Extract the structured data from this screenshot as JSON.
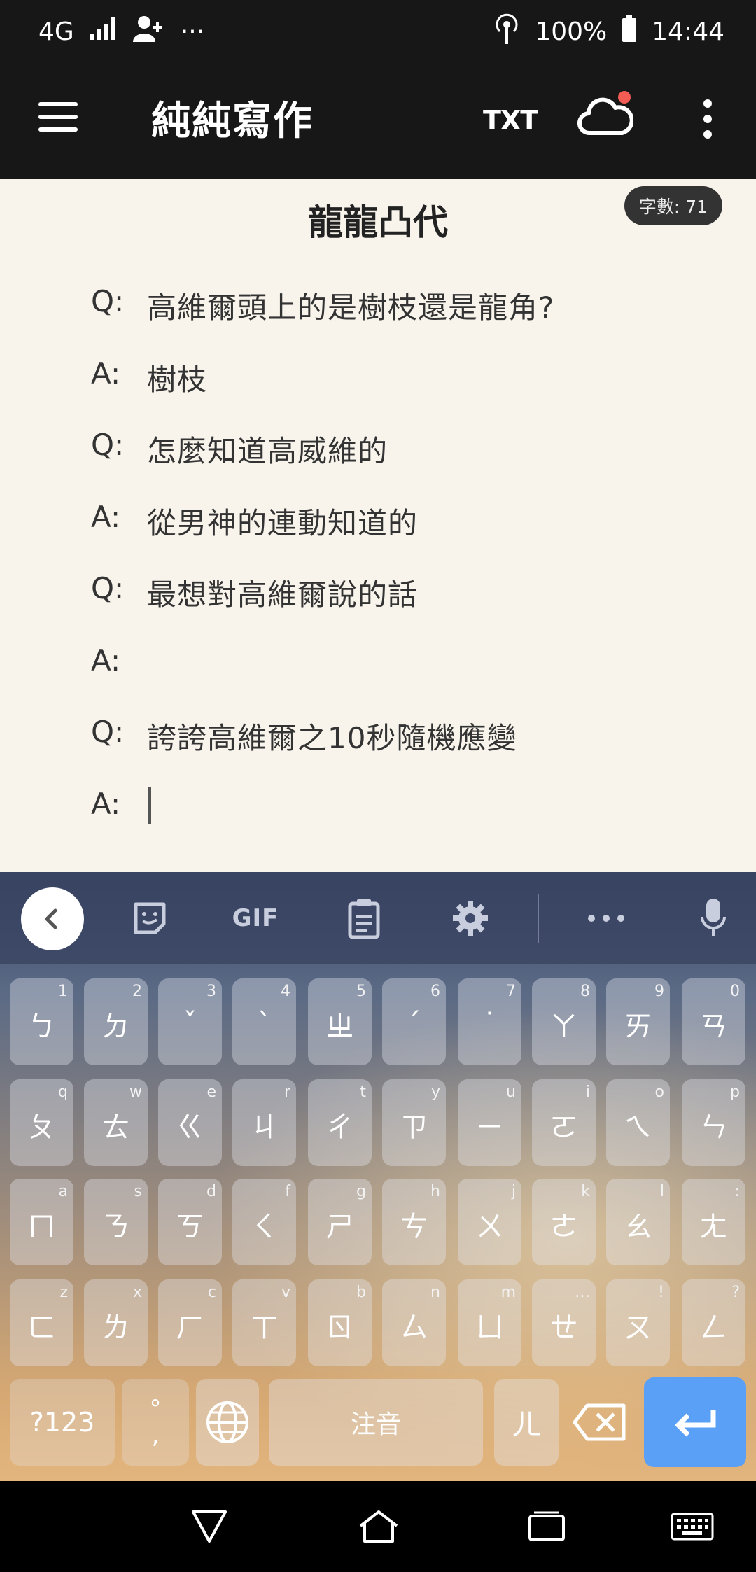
{
  "status_bar": {
    "network": "4G",
    "extras": "···",
    "battery": "100%",
    "time": "14:44"
  },
  "app_bar": {
    "title": "純純寫作",
    "txt_label": "TXT",
    "icons": [
      "menu-icon",
      "cloud-sync-icon",
      "more-vert-icon"
    ],
    "notification_dot_color": "#f25c54"
  },
  "editor": {
    "doc_title": "龍龍凸代",
    "word_count": "字數: 71",
    "lines": [
      {
        "prefix": "Q:",
        "text": "高維爾頭上的是樹枝還是龍角?"
      },
      {
        "prefix": "A:",
        "text": "樹枝"
      },
      {
        "prefix": "Q:",
        "text": "怎麼知道高威維的"
      },
      {
        "prefix": "A:",
        "text": "從男神的連動知道的"
      },
      {
        "prefix": "Q:",
        "text": "最想對高維爾說的話"
      },
      {
        "prefix": "A:",
        "text": ""
      },
      {
        "prefix": "Q:",
        "text": "誇誇高維爾之10秒隨機應變"
      },
      {
        "prefix": "A:",
        "text": ""
      }
    ]
  },
  "keyboard": {
    "toolbar": {
      "gif_label": "GIF",
      "icons": [
        "back-chevron-icon",
        "sticker-icon",
        "clipboard-icon",
        "settings-icon",
        "more-horiz-icon",
        "microphone-icon"
      ]
    },
    "rows": [
      [
        {
          "k": "ㄅ",
          "h": "1"
        },
        {
          "k": "ㄉ",
          "h": "2"
        },
        {
          "k": "ˇ",
          "h": "3"
        },
        {
          "k": "ˋ",
          "h": "4"
        },
        {
          "k": "ㄓ",
          "h": "5"
        },
        {
          "k": "ˊ",
          "h": "6"
        },
        {
          "k": "˙",
          "h": "7"
        },
        {
          "k": "ㄚ",
          "h": "8"
        },
        {
          "k": "ㄞ",
          "h": "9"
        },
        {
          "k": "ㄢ",
          "h": "0"
        }
      ],
      [
        {
          "k": "ㄆ",
          "h": "q"
        },
        {
          "k": "ㄊ",
          "h": "w"
        },
        {
          "k": "ㄍ",
          "h": "e"
        },
        {
          "k": "ㄐ",
          "h": "r"
        },
        {
          "k": "ㄔ",
          "h": "t"
        },
        {
          "k": "ㄗ",
          "h": "y"
        },
        {
          "k": "ㄧ",
          "h": "u"
        },
        {
          "k": "ㄛ",
          "h": "i"
        },
        {
          "k": "ㄟ",
          "h": "o"
        },
        {
          "k": "ㄣ",
          "h": "p"
        }
      ],
      [
        {
          "k": "ㄇ",
          "h": "a"
        },
        {
          "k": "ㄋ",
          "h": "s"
        },
        {
          "k": "ㄎ",
          "h": "d"
        },
        {
          "k": "ㄑ",
          "h": "f"
        },
        {
          "k": "ㄕ",
          "h": "g"
        },
        {
          "k": "ㄘ",
          "h": "h"
        },
        {
          "k": "ㄨ",
          "h": "j"
        },
        {
          "k": "ㄜ",
          "h": "k"
        },
        {
          "k": "ㄠ",
          "h": "l"
        },
        {
          "k": "ㄤ",
          "h": ":"
        }
      ],
      [
        {
          "k": "ㄈ",
          "h": "z"
        },
        {
          "k": "ㄌ",
          "h": "x"
        },
        {
          "k": "ㄏ",
          "h": "c"
        },
        {
          "k": "ㄒ",
          "h": "v"
        },
        {
          "k": "ㄖ",
          "h": "b"
        },
        {
          "k": "ㄙ",
          "h": "n"
        },
        {
          "k": "ㄩ",
          "h": "m"
        },
        {
          "k": "ㄝ",
          "h": "…"
        },
        {
          "k": "ㄡ",
          "h": "!"
        },
        {
          "k": "ㄥ",
          "h": "?"
        }
      ]
    ],
    "bottom": {
      "symbols_label": "?123",
      "punct_label": "°\n,",
      "space_label": "注音",
      "er_label": "ㄦ",
      "icons": [
        "globe-icon",
        "backspace-icon",
        "enter-icon"
      ],
      "enter_color": "#5aa0f7"
    }
  },
  "nav_bar": {
    "icons": [
      "back-triangle-icon",
      "home-icon",
      "recents-icon",
      "keyboard-icon"
    ]
  }
}
